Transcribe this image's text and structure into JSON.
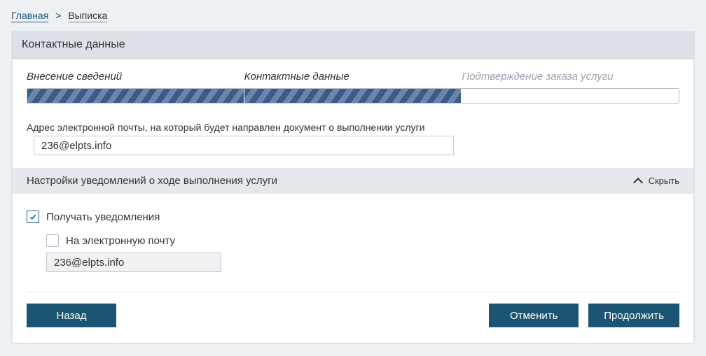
{
  "breadcrumb": {
    "home": "Главная",
    "current": "Выписка"
  },
  "header": {
    "title": "Контактные данные"
  },
  "steps": {
    "s1": "Внесение сведений",
    "s2": "Контактные данные",
    "s3": "Подтверждение заказа услуги"
  },
  "emailBlock": {
    "label": "Адрес электронной почты, на который будет направлен документ о выполнении услуги",
    "value": "236@elpts.info"
  },
  "section": {
    "title": "Настройки уведомлений о ходе выполнения услуги",
    "toggle_label": "Скрыть"
  },
  "settings": {
    "receive_label": "Получать уведомления",
    "by_email_label": "На электронную почту",
    "email_value": "236@elpts.info"
  },
  "buttons": {
    "back": "Назад",
    "cancel": "Отменить",
    "next": "Продолжить"
  }
}
